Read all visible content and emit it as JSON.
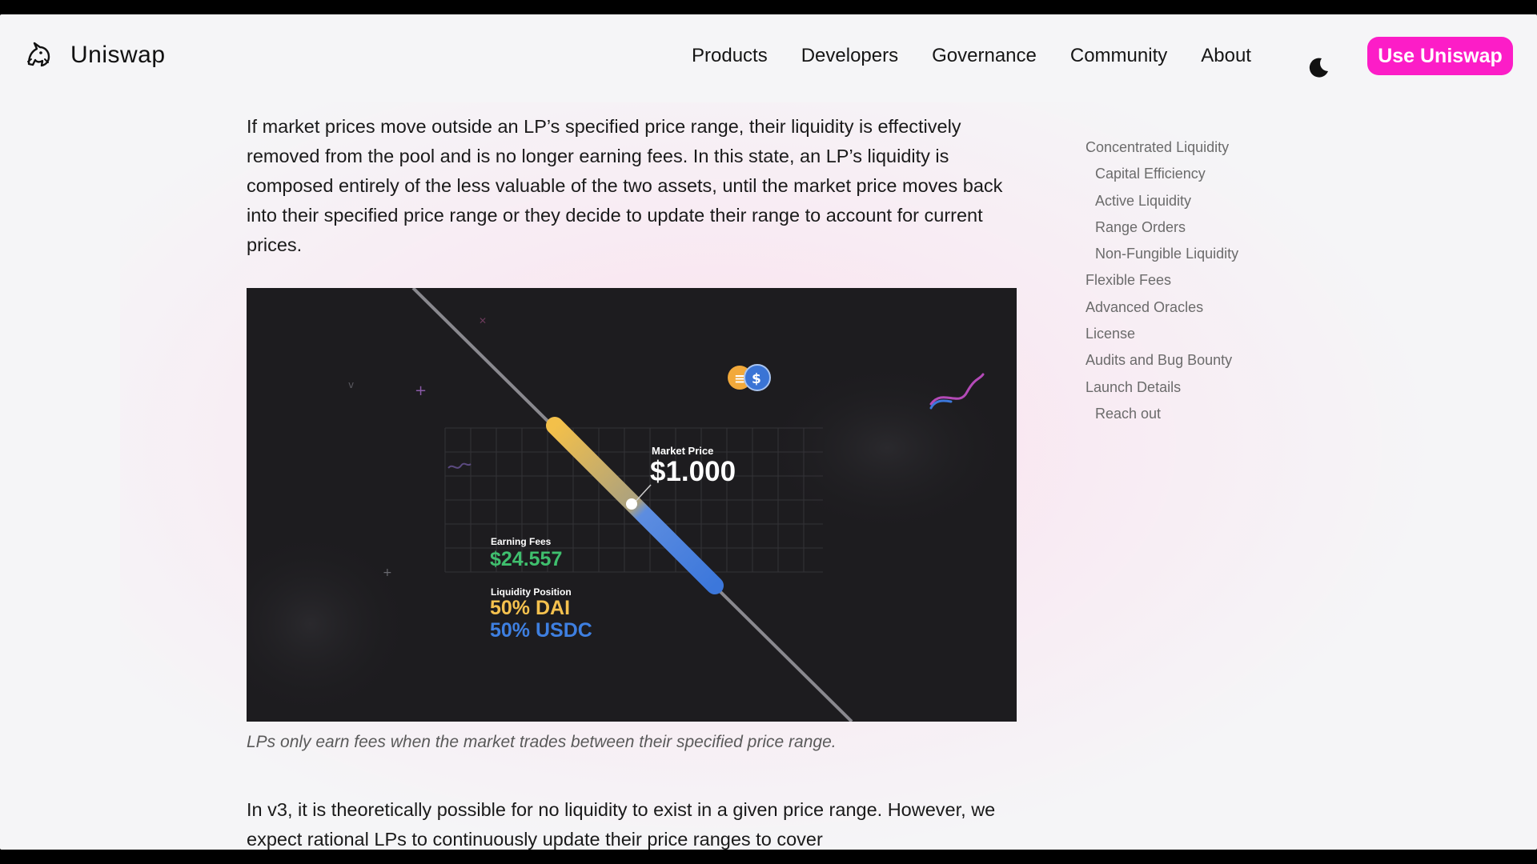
{
  "header": {
    "brand": "Uniswap",
    "nav": [
      "Products",
      "Developers",
      "Governance",
      "Community",
      "About"
    ],
    "cta_label": "Use Uniswap",
    "cta_color": "#fc1dc7"
  },
  "icons": {
    "logo": "unicorn-logo-icon",
    "theme": "moon-icon"
  },
  "article": {
    "paragraph_1": "If market prices move outside an LP’s specified price range, their liquidity is effectively removed from the pool and is no longer earning fees. In this state, an LP’s liquidity is composed entirely of the less valuable of the two assets, until the market price moves back into their specified price range or they decide to update their range to account for current prices.",
    "figure": {
      "market_price_label": "Market Price",
      "market_price_value": "$1.000",
      "earning_fees_label": "Earning Fees",
      "earning_fees_value": "$24.557",
      "liquidity_position_label": "Liquidity Position",
      "dai_share": "50% DAI",
      "usdc_share": "50% USDC"
    },
    "caption": "LPs only earn fees when the market trades between their specified price range.",
    "paragraph_2": "In v3, it is theoretically possible for no liquidity to exist in a given price range. However, we expect rational LPs to continuously update their price ranges to cover"
  },
  "toc": [
    {
      "label": "Concentrated Liquidity",
      "level": 1
    },
    {
      "label": "Capital Efficiency",
      "level": 2
    },
    {
      "label": "Active Liquidity",
      "level": 2
    },
    {
      "label": "Range Orders",
      "level": 2
    },
    {
      "label": "Non-Fungible Liquidity",
      "level": 2
    },
    {
      "label": "Flexible Fees",
      "level": 1
    },
    {
      "label": "Advanced Oracles",
      "level": 1
    },
    {
      "label": "License",
      "level": 1
    },
    {
      "label": "Audits and Bug Bounty",
      "level": 1
    },
    {
      "label": "Launch Details",
      "level": 1
    },
    {
      "label": "Reach out",
      "level": 2
    }
  ]
}
